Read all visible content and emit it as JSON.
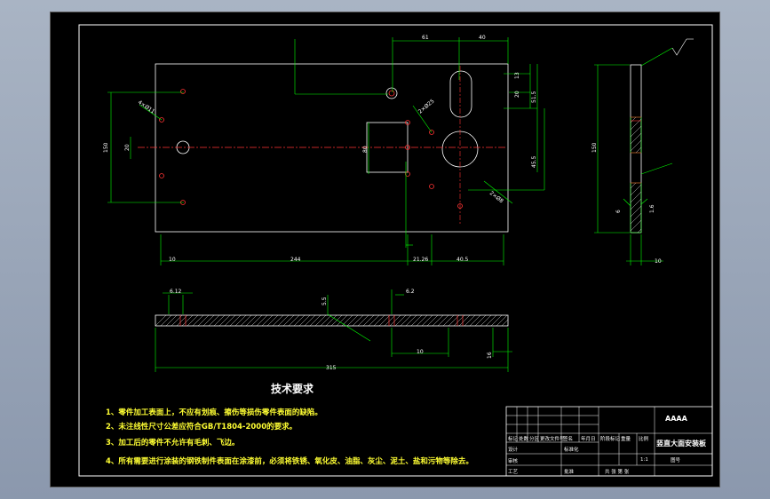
{
  "drawing": {
    "tech_title": "技术要求",
    "notes": [
      "1、零件加工表面上，不应有划痕、擦伤等损伤零件表面的缺陷。",
      "2、未注线性尺寸公差应符合GB/T1804-2000的要求。",
      "3、加工后的零件不允许有毛刺、飞边。",
      "4、所有需要进行涂装的钢铁制件表面在涂漆前，必须将铁锈、氧化皮、油脂、灰尘、泥土、盐和污物等除去。"
    ],
    "front_view_dims": {
      "top_61": "61",
      "top_40": "40",
      "left_150": "150",
      "left_20": "20",
      "right_13": "13",
      "right_20": "20",
      "right_51_5": "51.5",
      "right_45_5": "45.5",
      "mid_80": "80",
      "bottom_10": "10",
      "bottom_244": "244",
      "bottom_21_26": "21.26",
      "bottom_40_5": "40.5",
      "dia_label": "4×Ø11",
      "angle_label": "2×Ø25",
      "chamfer_label": "2×Ø8"
    },
    "side_view_dims": {
      "height_150": "150",
      "width_10": "10",
      "thk_6": "6",
      "thk_1_6": "1.6"
    },
    "section_view_dims": {
      "left_6_12": "6.12",
      "mid_5_5": "5.5",
      "right_6_2": "6.2",
      "total_315": "315",
      "depth_10": "10",
      "depth_16": "16"
    },
    "title_block": {
      "code": "AAAA",
      "part_name": "竖直大面安装板",
      "scale": "1:1",
      "drawing_no": "图号",
      "mark_cols": [
        "标记",
        "处数",
        "分区",
        "更改文件号",
        "签名",
        "年月日"
      ],
      "role_design": "设计",
      "role_std": "标准化",
      "role_check": "审核",
      "role_process": "工艺",
      "role_approve": "批准",
      "stage_label": "阶段标记",
      "weight_label": "重量",
      "scale_label": "比例",
      "sheet_label": "共  张  第  张"
    }
  }
}
